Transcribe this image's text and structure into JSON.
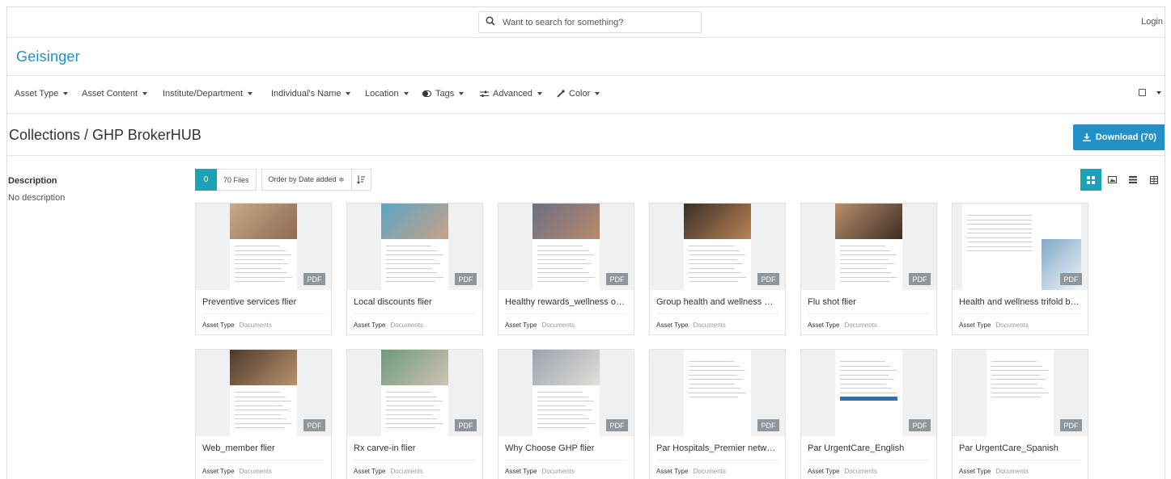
{
  "header": {
    "search_placeholder": "Want to search for something?",
    "login_label": "Login"
  },
  "brand": {
    "logo_text": "Geisinger",
    "accent_color": "#2390c7",
    "teal_color": "#1aa3b8"
  },
  "filters": [
    {
      "label": "Asset Type",
      "icon": ""
    },
    {
      "label": "Asset Content",
      "icon": ""
    },
    {
      "label": "Institute/Department",
      "icon": ""
    },
    {
      "label": "Individual's Name",
      "icon": ""
    },
    {
      "label": "Location",
      "icon": ""
    },
    {
      "label": "Tags",
      "icon": "toggle-icon"
    },
    {
      "label": "Advanced",
      "icon": "sliders-icon"
    },
    {
      "label": "Color",
      "icon": "eyedropper-icon"
    }
  ],
  "page": {
    "title": "Collections / GHP BrokerHUB",
    "download_label": "Download (70)"
  },
  "description": {
    "label": "Description",
    "text": "No description"
  },
  "toolbar": {
    "selected_count": "0",
    "files_label": "70 Files",
    "order_label": "Order by Date added ≑"
  },
  "view_modes": [
    "grid-view-icon",
    "image-view-icon",
    "list-view-icon",
    "table-view-icon"
  ],
  "assets": [
    {
      "name": "Preventive services flier",
      "type_label": "Asset Type",
      "type_value": "Documents",
      "badge": "PDF",
      "photo": "family"
    },
    {
      "name": "Local discounts flier",
      "type_label": "Asset Type",
      "type_value": "Documents",
      "badge": "PDF",
      "photo": "pool"
    },
    {
      "name": "Healthy rewards_wellness onli...",
      "type_label": "Asset Type",
      "type_value": "Documents",
      "badge": "PDF",
      "photo": "group"
    },
    {
      "name": "Group health and wellness off...",
      "type_label": "Asset Type",
      "type_value": "Documents",
      "badge": "PDF",
      "photo": "woman"
    },
    {
      "name": "Flu shot flier",
      "type_label": "Asset Type",
      "type_value": "Documents",
      "badge": "PDF",
      "photo": "child"
    },
    {
      "name": "Health and wellness trifold bro...",
      "type_label": "Asset Type",
      "type_value": "Documents",
      "badge": "PDF",
      "photo": "trifold"
    },
    {
      "name": "Web_member flier",
      "type_label": "Asset Type",
      "type_value": "Documents",
      "badge": "PDF",
      "photo": "cafe"
    },
    {
      "name": "Rx carve-in flier",
      "type_label": "Asset Type",
      "type_value": "Documents",
      "badge": "PDF",
      "photo": "man"
    },
    {
      "name": "Why Choose GHP flier",
      "type_label": "Asset Type",
      "type_value": "Documents",
      "badge": "PDF",
      "photo": "office"
    },
    {
      "name": "Par Hospitals_Premier networ...",
      "type_label": "Asset Type",
      "type_value": "Documents",
      "badge": "PDF",
      "photo": "list"
    },
    {
      "name": "Par UrgentCare_English",
      "type_label": "Asset Type",
      "type_value": "Documents",
      "badge": "PDF",
      "photo": "text"
    },
    {
      "name": "Par UrgentCare_Spanish",
      "type_label": "Asset Type",
      "type_value": "Documents",
      "badge": "PDF",
      "photo": "text2"
    }
  ]
}
